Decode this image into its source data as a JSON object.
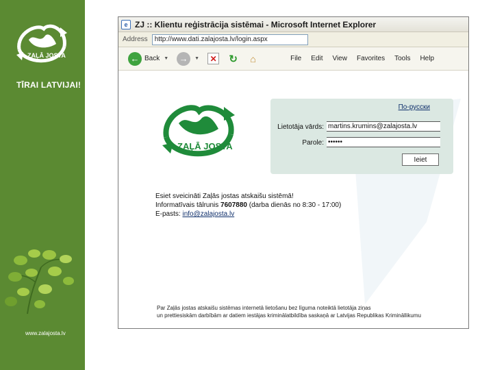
{
  "slide": {
    "brand_badge": "ZAĻĀ JOSTA",
    "slogan": "TĪRAI LATVIJAI!",
    "website": "www.zalajosta.lv",
    "band_color": "#5b8a32"
  },
  "browser": {
    "title": "ZJ :: Klientu reģistrācija sistēmai - Microsoft Internet Explorer",
    "address_label": "Address",
    "address_value": "http://www.dati.zalajosta.lv/login.aspx",
    "toolbar": {
      "back_label": "Back",
      "icons": [
        "back-arrow-icon",
        "forward-arrow-icon",
        "stop-icon",
        "refresh-icon",
        "home-icon"
      ]
    },
    "menu": [
      "File",
      "Edit",
      "View",
      "Favorites",
      "Tools",
      "Help"
    ]
  },
  "page": {
    "logo_text": "ZAĻĀ JOSTA",
    "lang_link": "По-русски",
    "form": {
      "username_label": "Lietotāja vārds:",
      "username_value": "martins.krumins@zalajosta.lv",
      "password_label": "Parole:",
      "password_value": "••••••",
      "submit_label": "Ieiet"
    },
    "welcome_line1": "Esiet sveicināti Zaļās jostas atskaišu sistēmā!",
    "welcome_line2_prefix": "Informatīvais tālrunis",
    "phone": "7607880",
    "welcome_line2_suffix": "(darba dienās no 8:30 - 17:00)",
    "email_prefix": "E-pasts:",
    "email": "info@zalajosta.lv",
    "footer_line1": "Par Zaļās jostas atskaišu sistēmas internetā lietošanu bez līguma noteiktā lietotāja ziņas",
    "footer_line2": "un prettiesiskām darbībām ar datiem iestājas kriminālatbildība saskaņā ar Latvijas Republikas Krimināllikumu"
  }
}
